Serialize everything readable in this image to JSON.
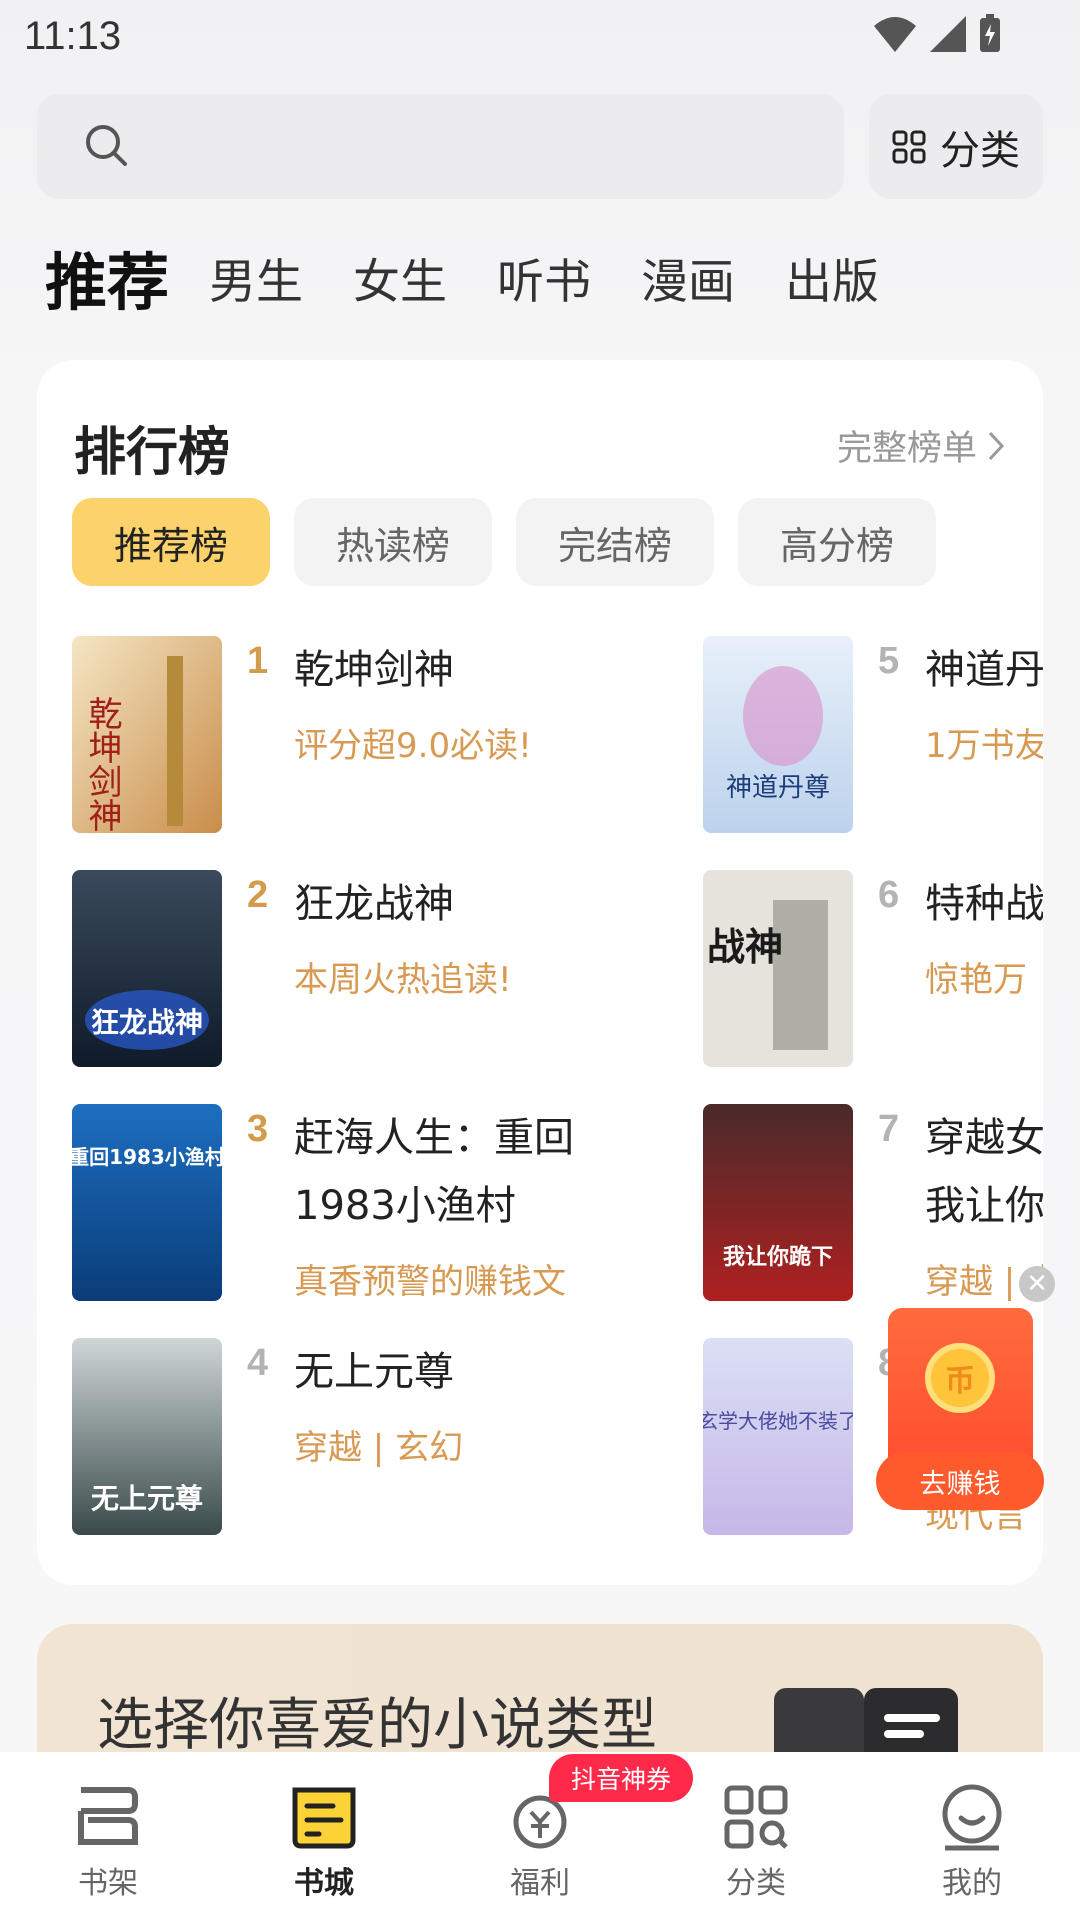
{
  "status_bar": {
    "time": "11:13"
  },
  "search": {
    "placeholder": ""
  },
  "category_button": {
    "label": "分类"
  },
  "channel_tabs": [
    {
      "label": "推荐",
      "active": true
    },
    {
      "label": "男生"
    },
    {
      "label": "女生"
    },
    {
      "label": "听书"
    },
    {
      "label": "漫画"
    },
    {
      "label": "出版"
    }
  ],
  "ranking": {
    "title": "排行榜",
    "more_label": "完整榜单",
    "pills": [
      "推荐榜",
      "热读榜",
      "完结榜",
      "高分榜"
    ],
    "active_pill": "推荐榜",
    "books": [
      {
        "rank": "1",
        "title": "乾坤剑神",
        "tag": "评分超9.0必读!"
      },
      {
        "rank": "2",
        "title": "狂龙战神",
        "tag": "本周火热追读!"
      },
      {
        "rank": "3",
        "title": "赶海人生：重回1983小渔村",
        "tag": "真香预警的赚钱文"
      },
      {
        "rank": "4",
        "title": "无上元尊",
        "tag": "穿越 | 玄幻"
      },
      {
        "rank": "5",
        "title": "神道丹",
        "tag": "1万书友"
      },
      {
        "rank": "6",
        "title": "特种战",
        "tag": "惊艳万"
      },
      {
        "rank": "7",
        "title": "穿越女 我让你",
        "tag": "穿越 | 古"
      },
      {
        "rank": "8",
        "title": "",
        "tag": "现代言"
      }
    ],
    "cover_texts": {
      "b1": "乾坤剑神",
      "b2": "狂龙战神",
      "b3": "重回1983小渔村",
      "b4": "无上元尊",
      "b5": "神道丹尊",
      "b6": "战神",
      "b7": "我让你跪下",
      "b8": "玄学大佬她不装了"
    }
  },
  "earn_float": {
    "label": "去赚钱",
    "coin": "币"
  },
  "genre_banner": {
    "title": "选择你喜爱的小说类型"
  },
  "bottom_nav": {
    "items": [
      {
        "label": "书架",
        "icon": "bookshelf-icon"
      },
      {
        "label": "书城",
        "icon": "bookstore-icon",
        "active": true
      },
      {
        "label": "福利",
        "icon": "welfare-icon"
      },
      {
        "label": "分类",
        "icon": "category-icon"
      },
      {
        "label": "我的",
        "icon": "profile-icon"
      }
    ],
    "badge": "抖音神券"
  },
  "colors": {
    "accent_yellow": "#fcd36b",
    "tag_orange": "#d89a52",
    "badge_red": "#ff2a4a"
  }
}
